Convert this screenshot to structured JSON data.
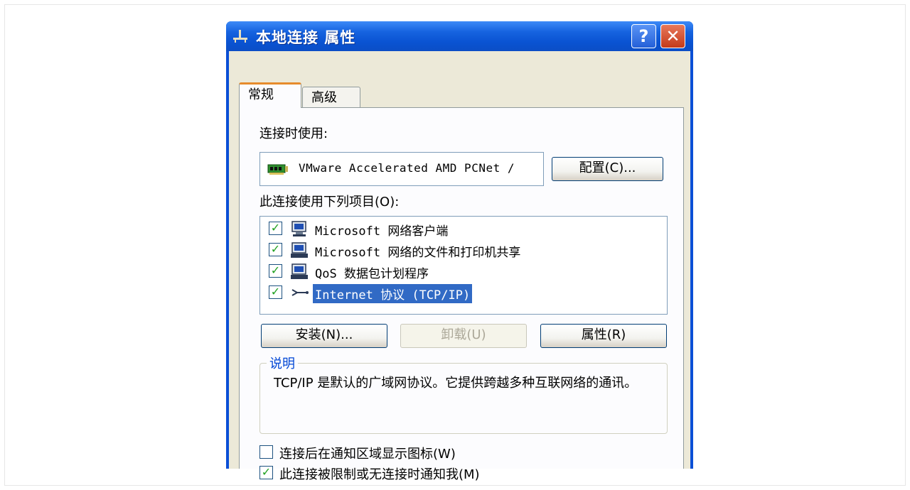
{
  "window": {
    "title": "本地连接 属性",
    "help_label": "?",
    "close_label": "✕"
  },
  "tabs": [
    {
      "label": "常规",
      "active": true
    },
    {
      "label": "高级",
      "active": false
    }
  ],
  "general": {
    "connect_using_label": "连接时使用:",
    "adapter_name": "VMware Accelerated AMD PCNet /",
    "adapter_icon": "network-adapter-icon",
    "configure_button": "配置(C)...",
    "components_label": "此连接使用下列项目(O):",
    "components": [
      {
        "label": "Microsoft 网络客户端",
        "checked": true,
        "icon": "network-client-icon",
        "selected": false
      },
      {
        "label": "Microsoft 网络的文件和打印机共享",
        "checked": true,
        "icon": "network-service-icon",
        "selected": false
      },
      {
        "label": "QoS 数据包计划程序",
        "checked": true,
        "icon": "network-service-icon",
        "selected": false
      },
      {
        "label": "Internet 协议 (TCP/IP)",
        "checked": true,
        "icon": "protocol-icon",
        "selected": true
      }
    ],
    "install_button": "安装(N)...",
    "uninstall_button": "卸载(U)",
    "properties_button": "属性(R)",
    "description_legend": "说明",
    "description_text": "TCP/IP 是默认的广域网协议。它提供跨越多种互联网络的通讯。",
    "show_icon_option": {
      "label": "连接后在通知区域显示图标(W)",
      "checked": false
    },
    "notify_option": {
      "label": "此连接被限制或无连接时通知我(M)",
      "checked": true
    }
  },
  "colors": {
    "title_bar": "#0a53d2",
    "selection": "#316ac5",
    "annotation_arrow": "#e8352b"
  }
}
